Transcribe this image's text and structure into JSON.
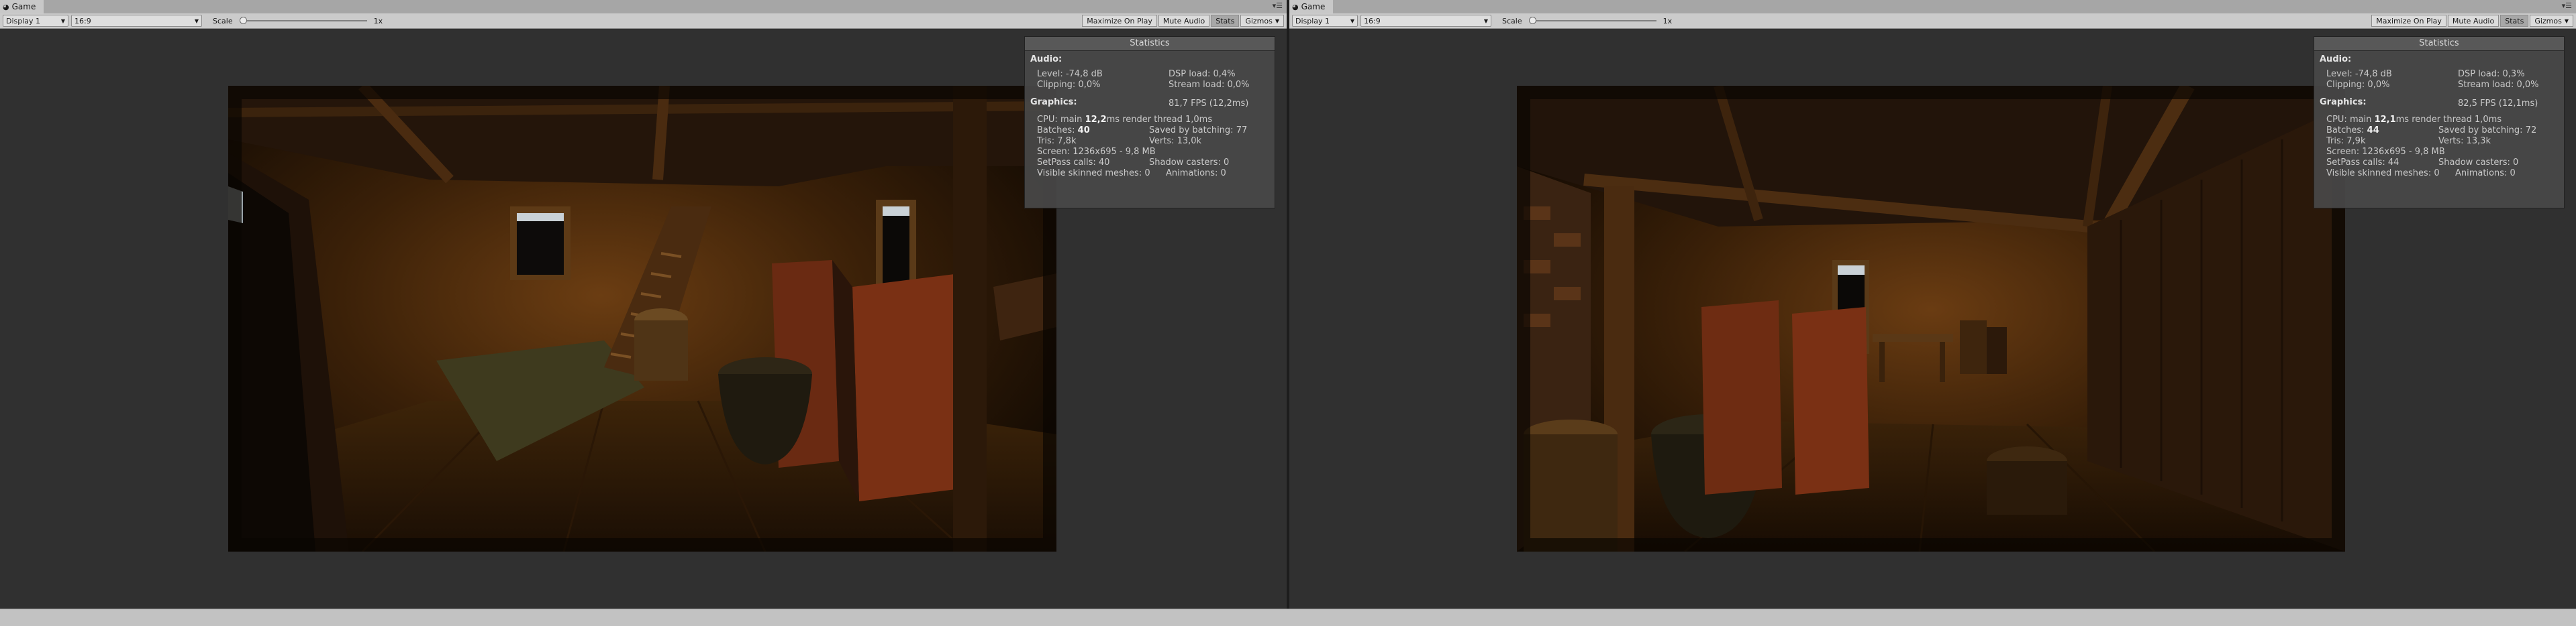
{
  "panes": [
    {
      "tab_title": "Game",
      "display": "Display 1",
      "aspect": "16:9",
      "scale_label": "Scale",
      "scale_value": "1x",
      "buttons": {
        "maximize": "Maximize On Play",
        "mute": "Mute Audio",
        "stats": "Stats",
        "gizmos": "Gizmos"
      },
      "stats": {
        "title": "Statistics",
        "audio_label": "Audio:",
        "level": "Level: -74,8 dB",
        "clipping": "Clipping: 0,0%",
        "dsp": "DSP load: 0,4%",
        "stream": "Stream load: 0,0%",
        "graphics_label": "Graphics:",
        "fps": "81,7 FPS (12,2ms)",
        "cpu_prefix": "CPU: main ",
        "cpu_main": "12,2",
        "cpu_suffix": "ms  render thread 1,0ms",
        "batches_prefix": "Batches: ",
        "batches": "40",
        "saved": "Saved by batching: 77",
        "tris": "Tris: 7,8k",
        "verts": "Verts: 13,0k",
        "screen": "Screen: 1236x695 - 9,8 MB",
        "setpass": "SetPass calls: 40",
        "shadow": "Shadow casters: 0",
        "skinned": "Visible skinned meshes: 0",
        "anim": "Animations: 0"
      }
    },
    {
      "tab_title": "Game",
      "display": "Display 1",
      "aspect": "16:9",
      "scale_label": "Scale",
      "scale_value": "1x",
      "buttons": {
        "maximize": "Maximize On Play",
        "mute": "Mute Audio",
        "stats": "Stats",
        "gizmos": "Gizmos"
      },
      "stats": {
        "title": "Statistics",
        "audio_label": "Audio:",
        "level": "Level: -74,8 dB",
        "clipping": "Clipping: 0,0%",
        "dsp": "DSP load: 0,3%",
        "stream": "Stream load: 0,0%",
        "graphics_label": "Graphics:",
        "fps": "82,5 FPS (12,1ms)",
        "cpu_prefix": "CPU: main ",
        "cpu_main": "12,1",
        "cpu_suffix": "ms  render thread 1,0ms",
        "batches_prefix": "Batches: ",
        "batches": "44",
        "saved": "Saved by batching: 72",
        "tris": "Tris: 7,9k",
        "verts": "Verts: 13,3k",
        "screen": "Screen: 1236x695 - 9,8 MB",
        "setpass": "SetPass calls: 44",
        "shadow": "Shadow casters: 0",
        "skinned": "Visible skinned meshes: 0",
        "anim": "Animations: 0"
      }
    }
  ]
}
